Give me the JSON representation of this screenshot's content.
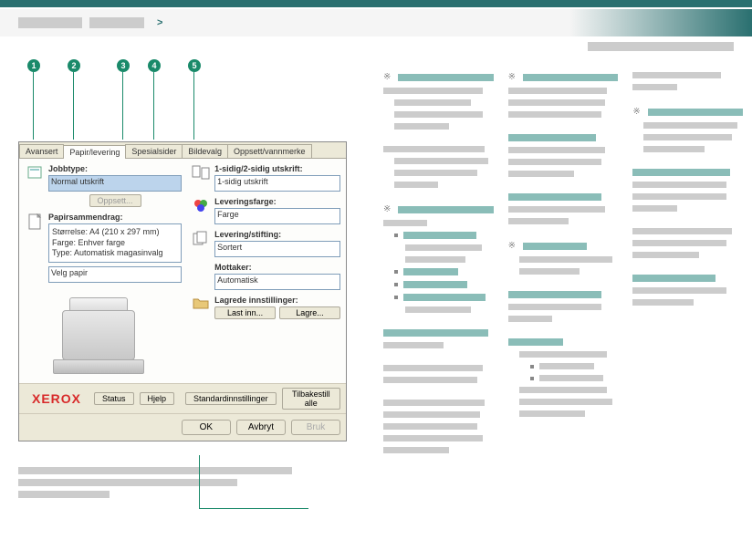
{
  "header": {
    "breadcrumb_separator": ">"
  },
  "callouts": [
    "1",
    "2",
    "3",
    "4",
    "5"
  ],
  "dialog": {
    "tabs": [
      "Avansert",
      "Papir/levering",
      "Spesialsider",
      "Bildevalg",
      "Oppsett/vannmerke"
    ],
    "active_tab": 1,
    "left": {
      "jobtype_label": "Jobbtype:",
      "jobtype_value": "Normal utskrift",
      "oppsett_btn": "Oppsett...",
      "papersummary_label": "Papirsammendrag:",
      "summary_lines": [
        "Størrelse: A4 (210 x 297 mm)",
        "Farge: Enhver farge",
        "Type: Automatisk magasinvalg"
      ],
      "velg_papir": "Velg papir"
    },
    "right": {
      "sides_label": "1-sidig/2-sidig utskrift:",
      "sides_value": "1-sidig utskrift",
      "color_label": "Leveringsfarge:",
      "color_value": "Farge",
      "finish_label": "Levering/stifting:",
      "finish_value": "Sortert",
      "dest_label": "Mottaker:",
      "dest_value": "Automatisk",
      "saved_label": "Lagrede innstillinger:",
      "load_btn": "Last inn...",
      "save_btn": "Lagre..."
    },
    "brand": "XEROX",
    "bottom": {
      "status": "Status",
      "help": "Hjelp",
      "defaults": "Standardinnstillinger",
      "reset": "Tilbakestill alle",
      "ok": "OK",
      "cancel": "Avbryt",
      "apply": "Bruk"
    }
  }
}
